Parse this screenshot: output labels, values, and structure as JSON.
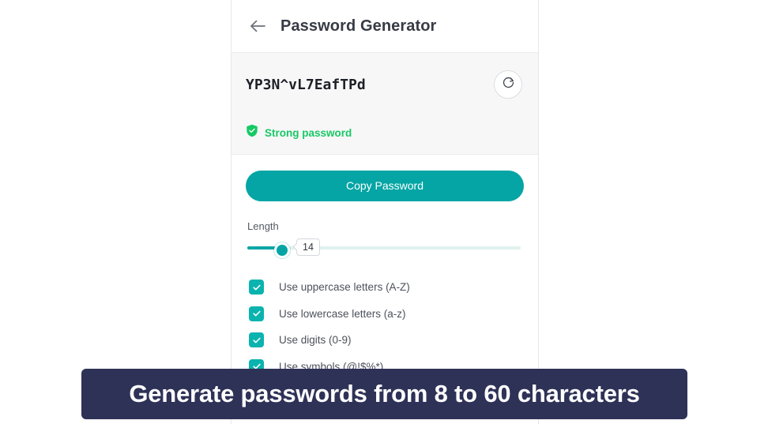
{
  "header": {
    "back_icon": "arrow-left-icon",
    "title": "Password Generator"
  },
  "password_panel": {
    "value": "YP3N^vL7EafTPd",
    "regenerate_icon": "refresh-icon",
    "strength_icon": "shield-check-icon",
    "strength_label": "Strong password",
    "strength_color": "#17c964"
  },
  "actions": {
    "copy_label": "Copy Password",
    "accent_color": "#05a5a5"
  },
  "length": {
    "label": "Length",
    "value": "14",
    "min": 8,
    "max": 60
  },
  "options": [
    {
      "label": "Use uppercase letters (A-Z)",
      "checked": true
    },
    {
      "label": "Use lowercase letters (a-z)",
      "checked": true
    },
    {
      "label": "Use digits (0-9)",
      "checked": true
    },
    {
      "label": "Use symbols (@!$%*)",
      "checked": true
    },
    {
      "label": "",
      "checked": true
    }
  ],
  "caption": {
    "text": "Generate passwords from 8 to 60 characters",
    "background": "#2e3257",
    "color": "#ffffff"
  }
}
